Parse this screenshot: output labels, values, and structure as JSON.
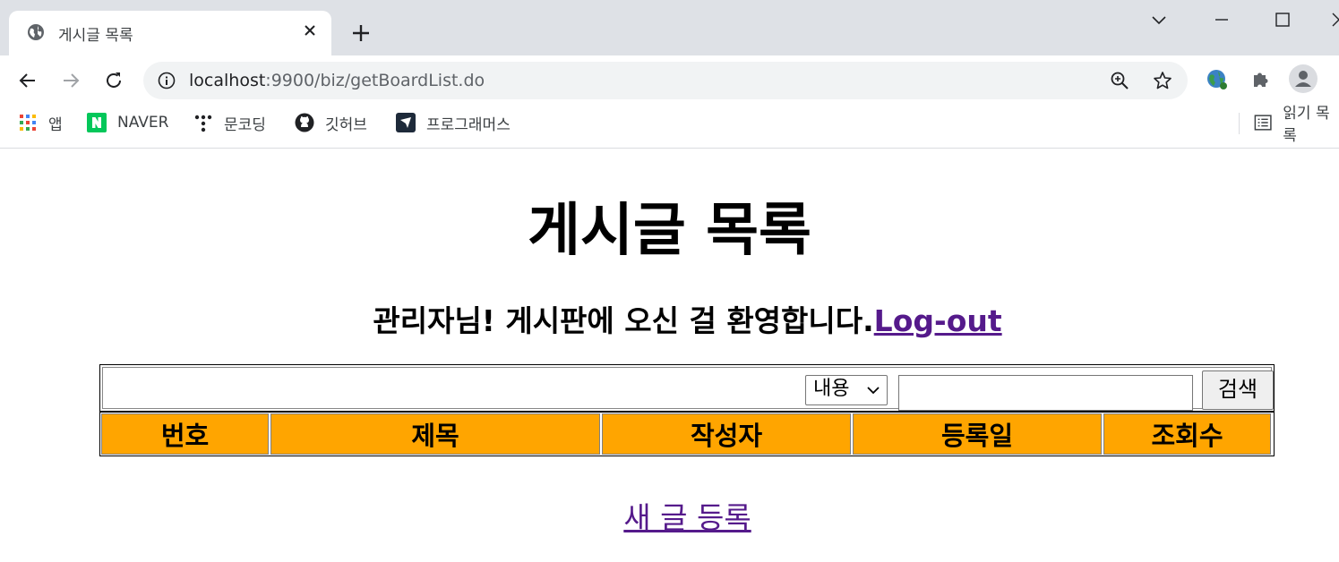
{
  "browser": {
    "tab_title": "게시글 목록",
    "url_host": "localhost",
    "url_path": ":9900/biz/getBoardList.do",
    "bookmarks": [
      {
        "label": "앱",
        "icon": "apps-grid-icon"
      },
      {
        "label": "NAVER",
        "icon": "naver-icon"
      },
      {
        "label": "문코딩",
        "icon": "moon-coding-icon"
      },
      {
        "label": "깃허브",
        "icon": "github-icon"
      },
      {
        "label": "프로그래머스",
        "icon": "programmers-icon"
      }
    ],
    "reading_list": "읽기 목록"
  },
  "page": {
    "title": "게시글 목록",
    "welcome_text": "관리자님! 게시판에 오신 걸 환영합니다.",
    "logout_label": "Log-out",
    "search": {
      "condition_selected": "내용",
      "keyword_value": "",
      "button_label": "검색"
    },
    "table": {
      "header_color": "#ffa500",
      "columns": [
        "번호",
        "제목",
        "작성자",
        "등록일",
        "조회수"
      ]
    },
    "new_post_label": "새 글 등록"
  }
}
